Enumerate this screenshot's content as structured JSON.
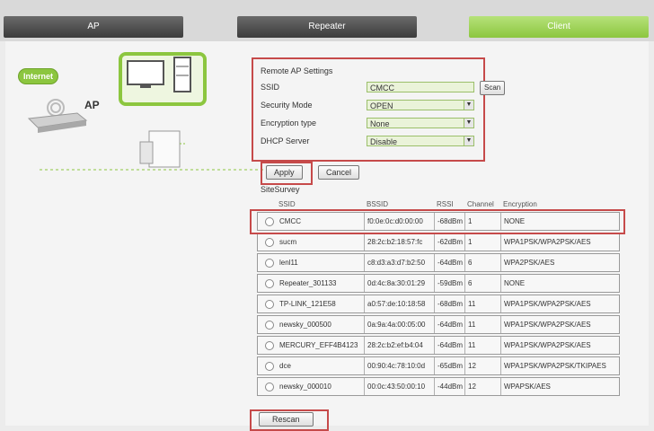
{
  "tabs": [
    {
      "label": "AP"
    },
    {
      "label": "Repeater"
    },
    {
      "label": "Client"
    }
  ],
  "diagram": {
    "internet_label": "Internet",
    "ap_label": "AP"
  },
  "remote_ap": {
    "title": "Remote AP Settings",
    "ssid_label": "SSID",
    "ssid_value": "CMCC",
    "scan_label": "Scan",
    "security_label": "Security Mode",
    "security_value": "OPEN",
    "encryption_label": "Encryption type",
    "encryption_value": "None",
    "dhcp_label": "DHCP Server",
    "dhcp_value": "Disable"
  },
  "buttons": {
    "apply": "Apply",
    "cancel": "Cancel",
    "rescan": "Rescan"
  },
  "site_survey": {
    "title": "SiteSurvey",
    "columns": [
      "SSID",
      "BSSID",
      "RSSI",
      "Channel",
      "Encryption"
    ],
    "rows": [
      {
        "ssid": "CMCC",
        "bssid": "f0:0e:0c:d0:00:00",
        "rssi": "-68dBm",
        "channel": "1",
        "enc": "NONE"
      },
      {
        "ssid": "sucm",
        "bssid": "28:2c:b2:18:57:fc",
        "rssi": "-62dBm",
        "channel": "1",
        "enc": "WPA1PSK/WPA2PSK/AES"
      },
      {
        "ssid": "lenl11",
        "bssid": "c8:d3:a3:d7:b2:50",
        "rssi": "-64dBm",
        "channel": "6",
        "enc": "WPA2PSK/AES"
      },
      {
        "ssid": "Repeater_301133",
        "bssid": "0d:4c:8a:30:01:29",
        "rssi": "-59dBm",
        "channel": "6",
        "enc": "NONE"
      },
      {
        "ssid": "TP-LINK_121E58",
        "bssid": "a0:57:de:10:18:58",
        "rssi": "-68dBm",
        "channel": "11",
        "enc": "WPA1PSK/WPA2PSK/AES"
      },
      {
        "ssid": "newsky_000500",
        "bssid": "0a:9a:4a:00:05:00",
        "rssi": "-64dBm",
        "channel": "11",
        "enc": "WPA1PSK/WPA2PSK/AES"
      },
      {
        "ssid": "MERCURY_EFF4B4123",
        "bssid": "28:2c:b2:ef:b4:04",
        "rssi": "-64dBm",
        "channel": "11",
        "enc": "WPA1PSK/WPA2PSK/AES"
      },
      {
        "ssid": "dce",
        "bssid": "00:90:4c:78:10:0d",
        "rssi": "-65dBm",
        "channel": "12",
        "enc": "WPA1PSK/WPA2PSK/TKIPAES"
      },
      {
        "ssid": "newsky_000010",
        "bssid": "00:0c:43:50:00:10",
        "rssi": "-44dBm",
        "channel": "12",
        "enc": "WPAPSK/AES"
      }
    ]
  },
  "colors": {
    "accent": "#8cc63f",
    "highlight": "#c64a4a"
  }
}
